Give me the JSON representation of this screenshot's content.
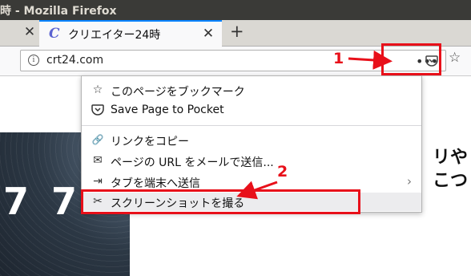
{
  "window": {
    "title": "時 - Mozilla Firefox"
  },
  "tabs": [
    {
      "label": "",
      "close": "✕"
    },
    {
      "label": "クリエイター24時",
      "favicon": "C",
      "close": "✕",
      "active": true
    }
  ],
  "toolbar": {
    "new_tab": "+",
    "more": "•••",
    "star": "☆"
  },
  "urlbar": {
    "info": "i",
    "url": "crt24.com"
  },
  "menu": {
    "items": [
      {
        "icon": "☆",
        "label": "このページをブックマーク"
      },
      {
        "icon": "pocket",
        "label": "Save Page to Pocket"
      },
      {
        "icon": "🔗",
        "label": "リンクをコピー"
      },
      {
        "icon": "✉",
        "label": "ページの URL をメールで送信..."
      },
      {
        "icon": "⇥",
        "label": "タブを端末へ送信",
        "arrow": "›"
      },
      {
        "icon": "✂",
        "label": "スクリーンショットを撮る"
      }
    ]
  },
  "page": {
    "big_numbers": [
      "7",
      "7"
    ],
    "heading_fragments": [
      "リや",
      "こつ"
    ]
  },
  "annotations": {
    "step1": "1",
    "step2": "2",
    "color": "#e8101a"
  },
  "colors": {
    "accent": "#0a84ff",
    "titlebar": "#3a3a37"
  }
}
